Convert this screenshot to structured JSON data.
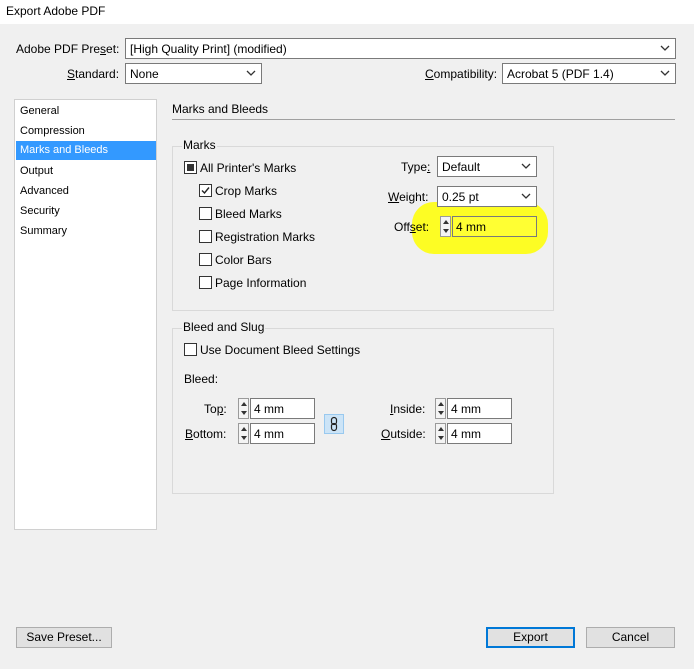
{
  "window": {
    "title": "Export Adobe PDF"
  },
  "preset": {
    "label": "Adobe PDF Preset:",
    "value": "[High Quality Print] (modified)"
  },
  "standard": {
    "label": "Standard:",
    "value": "None"
  },
  "compatibility": {
    "label": "Compatibility:",
    "value": "Acrobat 5 (PDF 1.4)"
  },
  "sidebar": {
    "items": [
      {
        "label": "General"
      },
      {
        "label": "Compression"
      },
      {
        "label": "Marks and Bleeds"
      },
      {
        "label": "Output"
      },
      {
        "label": "Advanced"
      },
      {
        "label": "Security"
      },
      {
        "label": "Summary"
      }
    ],
    "selected": "Marks and Bleeds"
  },
  "section": {
    "title": "Marks and Bleeds"
  },
  "marks": {
    "title": "Marks",
    "all_printers": {
      "label": "All Printer's Marks",
      "state": "partial"
    },
    "crop": {
      "label": "Crop Marks",
      "checked": true
    },
    "bleed": {
      "label": "Bleed Marks",
      "checked": false
    },
    "registration": {
      "label": "Registration Marks",
      "checked": false
    },
    "color_bars": {
      "label": "Color Bars",
      "checked": false
    },
    "page_info": {
      "label": "Page Information",
      "checked": false
    },
    "type": {
      "label": "Type:",
      "value": "Default"
    },
    "weight": {
      "label": "Weight:",
      "value": "0.25 pt"
    },
    "offset": {
      "label": "Offset:",
      "value": "4 mm"
    }
  },
  "bleed_slug": {
    "title": "Bleed and Slug",
    "use_doc": {
      "label": "Use Document Bleed Settings",
      "checked": false
    },
    "bleed_label": "Bleed:",
    "top": {
      "label": "Top:",
      "value": "4 mm"
    },
    "bottom": {
      "label": "Bottom:",
      "value": "4 mm"
    },
    "inside": {
      "label": "Inside:",
      "value": "4 mm"
    },
    "outside": {
      "label": "Outside:",
      "value": "4 mm"
    }
  },
  "buttons": {
    "save_preset": "Save Preset...",
    "export": "Export",
    "cancel": "Cancel"
  },
  "colors": {
    "selection": "#3399ff",
    "highlight": "#ffff00",
    "default_button_border": "#0078d7"
  },
  "icons": {
    "dropdown": "chevron-down-icon",
    "link": "chain-link-icon",
    "check": "checkmark-icon"
  }
}
